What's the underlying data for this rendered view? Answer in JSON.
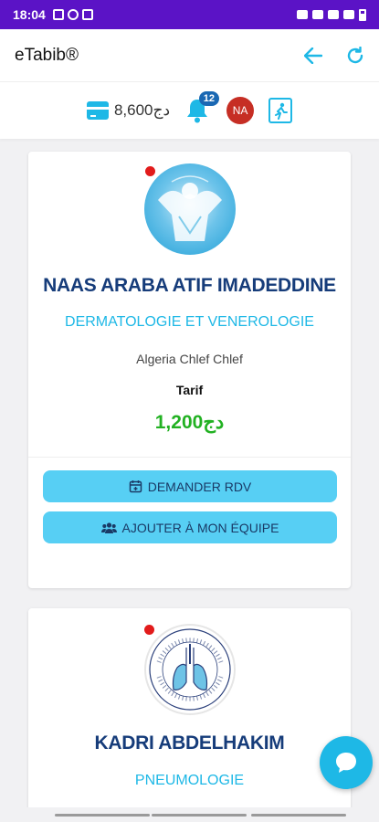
{
  "status_bar": {
    "time": "18:04"
  },
  "app_bar": {
    "title": "eTabib®"
  },
  "info_bar": {
    "balance": "8,600دج",
    "notification_count": "12",
    "user_initials": "NA"
  },
  "doctors": [
    {
      "name": "NAAS ARABA ATIF IMADEDDINE",
      "specialty": "DERMATOLOGIE ET VENEROLOGIE",
      "location": "Algeria Chlef Chlef",
      "tarif_label": "Tarif",
      "tarif_value": "1,200دج",
      "online": true
    },
    {
      "name": "KADRI ABDELHAKIM",
      "specialty": "PNEUMOLOGIE",
      "online": true
    }
  ],
  "buttons": {
    "request_appointment": "DEMANDER RDV",
    "add_to_team": "AJOUTER À MON ÉQUIPE"
  },
  "icons": {
    "back": "arrow-left-icon",
    "refresh": "refresh-icon",
    "wallet": "wallet-icon",
    "bell": "bell-icon",
    "exit": "exit-icon",
    "calendar": "calendar-plus-icon",
    "team": "users-icon",
    "chat": "chat-icon"
  },
  "colors": {
    "status_bar": "#5b13c6",
    "accent": "#1eb8e6",
    "name": "#163c7a",
    "price": "#22b122",
    "button": "#57cff4",
    "online": "#e21b1b",
    "avatar": "#c62e24",
    "badge": "#1a68b3"
  }
}
